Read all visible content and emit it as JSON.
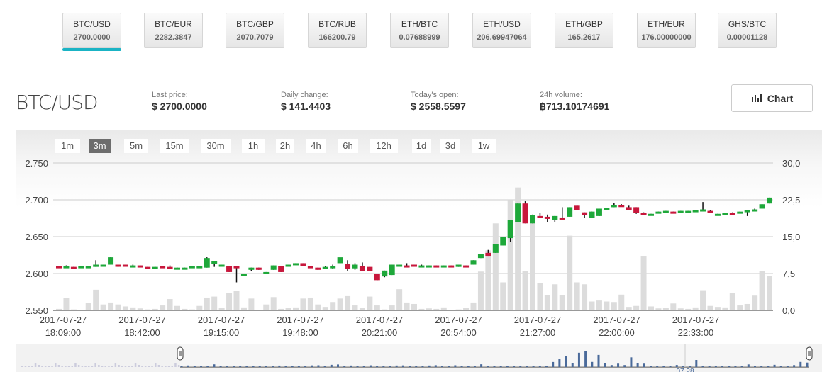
{
  "pairs": [
    {
      "name": "BTC/USD",
      "value": "2700.0000",
      "active": true
    },
    {
      "name": "BTC/EUR",
      "value": "2282.3847"
    },
    {
      "name": "BTC/GBP",
      "value": "2070.7079"
    },
    {
      "name": "BTC/RUB",
      "value": "166200.79"
    },
    {
      "name": "ETH/BTC",
      "value": "0.07688999"
    },
    {
      "name": "ETH/USD",
      "value": "206.69947064"
    },
    {
      "name": "ETH/GBP",
      "value": "165.2617"
    },
    {
      "name": "ETH/EUR",
      "value": "176.00000000"
    },
    {
      "name": "GHS/BTC",
      "value": "0.00001128"
    }
  ],
  "header": {
    "title": "BTC/USD",
    "stats": [
      {
        "label": "Last price:",
        "value": "$ 2700.0000"
      },
      {
        "label": "Daily change:",
        "value": "$ 141.4403"
      },
      {
        "label": "Today's open:",
        "value": "$ 2558.5597"
      },
      {
        "label": "24h volume:",
        "value": "฿713.10174691"
      }
    ],
    "chart_button": "Chart",
    "chart_icon": "bar-chart-icon"
  },
  "timeframes": {
    "items": [
      "1m",
      "3m",
      "5m",
      "15m",
      "30m",
      "1h",
      "2h",
      "4h",
      "6h",
      "12h",
      "1d",
      "3d",
      "1w"
    ],
    "active": "3m"
  },
  "chart_data": {
    "type": "candlestick",
    "price_axis": {
      "ticks": [
        "2.750",
        "2.700",
        "2.650",
        "2.600",
        "2.550"
      ],
      "range": [
        2550,
        2750
      ]
    },
    "volume_axis": {
      "ticks": [
        "30,0",
        "22,5",
        "15,0",
        "7,5",
        "0,0"
      ],
      "range": [
        0,
        30
      ]
    },
    "x_ticks": [
      {
        "date": "2017-07-27",
        "time": "18:09:00"
      },
      {
        "date": "2017-07-27",
        "time": "18:42:00"
      },
      {
        "date": "2017-07-27",
        "time": "19:15:00"
      },
      {
        "date": "2017-07-27",
        "time": "19:48:00"
      },
      {
        "date": "2017-07-27",
        "time": "20:21:00"
      },
      {
        "date": "2017-07-27",
        "time": "20:54:00"
      },
      {
        "date": "2017-07-27",
        "time": "21:27:00"
      },
      {
        "date": "2017-07-27",
        "time": "22:00:00"
      },
      {
        "date": "2017-07-27",
        "time": "22:33:00"
      }
    ],
    "colors": {
      "up": "#1ea83a",
      "down": "#c8173c",
      "volume": "#dcdcdc",
      "navigator": "#4a6a9a"
    },
    "candles_ohlcv": [
      [
        2610,
        2610,
        2608,
        2608,
        0.3
      ],
      [
        2608,
        2611,
        2608,
        2610,
        2.5
      ],
      [
        2609,
        2609,
        2608,
        2608,
        0.2
      ],
      [
        2608,
        2610,
        2608,
        2610,
        0.1
      ],
      [
        2608,
        2610,
        2608,
        2610,
        1.5
      ],
      [
        2609,
        2618,
        2609,
        2612,
        4.2
      ],
      [
        2610,
        2612,
        2610,
        2612,
        1.2
      ],
      [
        2612,
        2623,
        2612,
        2622,
        1.6
      ],
      [
        2612,
        2612,
        2609,
        2610,
        1.2
      ],
      [
        2612,
        2612,
        2610,
        2610,
        0.8
      ],
      [
        2610,
        2612,
        2610,
        2611,
        0.6
      ],
      [
        2611,
        2611,
        2609,
        2609,
        0.4
      ],
      [
        2609,
        2609,
        2607,
        2607,
        0.2
      ],
      [
        2607,
        2609,
        2607,
        2609,
        0.3
      ],
      [
        2610,
        2610,
        2608,
        2608,
        1.0
      ],
      [
        2609,
        2611,
        2606,
        2606,
        2.3
      ],
      [
        2606,
        2608,
        2606,
        2608,
        0.9
      ],
      [
        2608,
        2608,
        2606,
        2608,
        0.3
      ],
      [
        2608,
        2610,
        2608,
        2610,
        0.2
      ],
      [
        2608,
        2610,
        2608,
        2610,
        0.9
      ],
      [
        2608,
        2622,
        2608,
        2621,
        2.6
      ],
      [
        2613,
        2617,
        2609,
        2617,
        2.8
      ],
      [
        2610,
        2612,
        2610,
        2612,
        0.5
      ],
      [
        2610,
        2610,
        2602,
        2602,
        3.5
      ],
      [
        2610,
        2610,
        2588,
        2608,
        4.0
      ],
      [
        2598,
        2600,
        2598,
        2600,
        0.6
      ],
      [
        2605,
        2608,
        2603,
        2608,
        2.4
      ],
      [
        2608,
        2608,
        2605,
        2605,
        0.1
      ],
      [
        2600,
        2602,
        2600,
        2602,
        1.2
      ],
      [
        2605,
        2611,
        2605,
        2611,
        2.7
      ],
      [
        2610,
        2610,
        2602,
        2602,
        0.3
      ],
      [
        2610,
        2612,
        2610,
        2612,
        0.5
      ],
      [
        2612,
        2614,
        2612,
        2614,
        0.6
      ],
      [
        2614,
        2614,
        2610,
        2610,
        2.4
      ],
      [
        2610,
        2610,
        2608,
        2608,
        2.6
      ],
      [
        2608,
        2608,
        2605,
        2605,
        1.2
      ],
      [
        2606,
        2610,
        2606,
        2609,
        0.7
      ],
      [
        2608,
        2612,
        2606,
        2610,
        1.7
      ],
      [
        2614,
        2616,
        2614,
        2622,
        2.4
      ],
      [
        2613,
        2618,
        2603,
        2606,
        2.9
      ],
      [
        2607,
        2614,
        2605,
        2612,
        1.0
      ],
      [
        2610,
        2615,
        2605,
        2603,
        0.5
      ],
      [
        2609,
        2609,
        2603,
        2603,
        2.8
      ],
      [
        2600,
        2600,
        2591,
        2591,
        1.0
      ],
      [
        2596,
        2604,
        2595,
        2604,
        0.2
      ],
      [
        2598,
        2612,
        2598,
        2612,
        1.0
      ],
      [
        2610,
        2612,
        2610,
        2612,
        4.3
      ],
      [
        2611,
        2614,
        2609,
        2609,
        1.6
      ],
      [
        2612,
        2612,
        2610,
        2611,
        1.3
      ],
      [
        2610,
        2612,
        2610,
        2611,
        0.3
      ],
      [
        2611,
        2611,
        2610,
        2611,
        0.4
      ],
      [
        2611,
        2611,
        2609,
        2609,
        0.3
      ],
      [
        2609,
        2611,
        2609,
        2611,
        0.6
      ],
      [
        2611,
        2611,
        2609,
        2609,
        0.1
      ],
      [
        2609,
        2612,
        2609,
        2612,
        0.2
      ],
      [
        2611,
        2611,
        2609,
        2609,
        0.5
      ],
      [
        2612,
        2618,
        2612,
        2618,
        1.6
      ],
      [
        2621,
        2626,
        2621,
        2626,
        7.9
      ],
      [
        2628,
        2632,
        2624,
        2624,
        12.2
      ],
      [
        2628,
        2640,
        2628,
        2640,
        17.7
      ],
      [
        2638,
        2650,
        2638,
        2650,
        5.7
      ],
      [
        2648,
        2673,
        2643,
        2673,
        22.4
      ],
      [
        2670,
        2695,
        2670,
        2695,
        25.0
      ],
      [
        2695,
        2698,
        2668,
        2668,
        8.0
      ],
      [
        2668,
        2680,
        2668,
        2679,
        19.0
      ],
      [
        2678,
        2682,
        2676,
        2676,
        5.6
      ],
      [
        2677,
        2680,
        2670,
        2675,
        3.1
      ],
      [
        2673,
        2678,
        2670,
        2678,
        5.3
      ],
      [
        2676,
        2690,
        2676,
        2675,
        3.1
      ],
      [
        2677,
        2690,
        2677,
        2690,
        15.2
      ],
      [
        2692,
        2692,
        2686,
        2686,
        5.7
      ],
      [
        2683,
        2683,
        2675,
        2679,
        5.3
      ],
      [
        2675,
        2684,
        2675,
        2684,
        1.8
      ],
      [
        2678,
        2688,
        2678,
        2688,
        2.0
      ],
      [
        2686,
        2689,
        2686,
        2689,
        1.8
      ],
      [
        2690,
        2696,
        2690,
        2693,
        1.7
      ],
      [
        2693,
        2694,
        2691,
        2691,
        3.2
      ],
      [
        2690,
        2692,
        2686,
        2686,
        0.7
      ],
      [
        2690,
        2690,
        2681,
        2682,
        0.9
      ],
      [
        2682,
        2683,
        2679,
        2679,
        11.1
      ],
      [
        2679,
        2681,
        2679,
        2681,
        0.8
      ],
      [
        2682,
        2684,
        2682,
        2684,
        0.4
      ],
      [
        2683,
        2685,
        2683,
        2685,
        0.5
      ],
      [
        2684,
        2684,
        2682,
        2682,
        1.4
      ],
      [
        2683,
        2685,
        2683,
        2685,
        0.4
      ],
      [
        2683,
        2685,
        2683,
        2685,
        0.3
      ],
      [
        2684,
        2686,
        2684,
        2686,
        0.6
      ],
      [
        2686,
        2697,
        2686,
        2687,
        4.1
      ],
      [
        2685,
        2686,
        2684,
        2683,
        0.9
      ],
      [
        2679,
        2681,
        2679,
        2681,
        0.7
      ],
      [
        2680,
        2682,
        2680,
        2682,
        0.6
      ],
      [
        2682,
        2683,
        2681,
        2681,
        3.5
      ],
      [
        2682,
        2684,
        2682,
        2684,
        1.0
      ],
      [
        2684,
        2686,
        2678,
        2686,
        1.3
      ],
      [
        2686,
        2688,
        2686,
        2687,
        3.0
      ],
      [
        2688,
        2694,
        2688,
        2694,
        8.0
      ],
      [
        2695,
        2703,
        2695,
        2703,
        7.0
      ]
    ],
    "navigator_label": "07.28"
  }
}
